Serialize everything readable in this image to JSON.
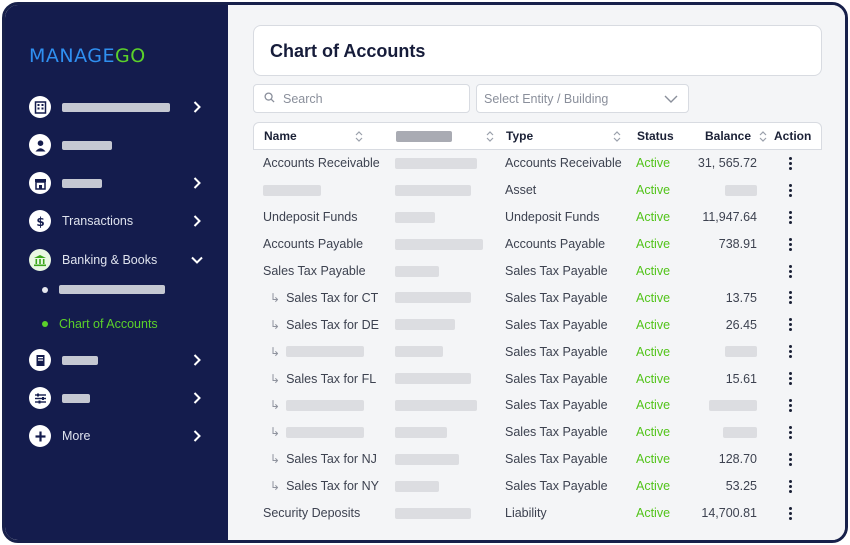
{
  "brand": {
    "logo_part1": "MANAGE",
    "logo_part2": "GO"
  },
  "sidebar": {
    "items": [
      {
        "name": "nav-properties",
        "icon": "building-icon",
        "label": "",
        "chevron": "right"
      },
      {
        "name": "nav-people",
        "icon": "person-icon",
        "label": "",
        "chevron": ""
      },
      {
        "name": "nav-leasing",
        "icon": "store-icon",
        "label": "",
        "chevron": "right"
      },
      {
        "name": "nav-transactions",
        "icon": "dollar-icon",
        "label": "Transactions",
        "chevron": "right"
      },
      {
        "name": "nav-banking",
        "icon": "bank-icon",
        "label": "Banking & Books",
        "chevron": "down"
      },
      {
        "name": "nav-documents",
        "icon": "document-icon",
        "label": "",
        "chevron": "right"
      },
      {
        "name": "nav-settings",
        "icon": "sliders-icon",
        "label": "",
        "chevron": "right"
      },
      {
        "name": "nav-more",
        "icon": "plus-icon",
        "label": "More",
        "chevron": "right"
      }
    ],
    "subitems": [
      {
        "label": "",
        "active": false
      },
      {
        "label": "Chart of Accounts",
        "active": true
      }
    ]
  },
  "page": {
    "title": "Chart of Accounts"
  },
  "filters": {
    "search_placeholder": "Search",
    "entity_select": "Select Entity / Building"
  },
  "table": {
    "columns": {
      "name": "Name",
      "col2": "",
      "type": "Type",
      "status": "Status",
      "balance": "Balance",
      "action": "Action"
    },
    "rows": [
      {
        "name": "Accounts Receivable",
        "indent": false,
        "type": "Accounts Receivable",
        "status": "Active",
        "balance": "31, 565.72"
      },
      {
        "name": "",
        "indent": false,
        "type": "Asset",
        "status": "Active",
        "balance": ""
      },
      {
        "name": "Undeposit Funds",
        "indent": false,
        "type": "Undeposit Funds",
        "status": "Active",
        "balance": "11,947.64"
      },
      {
        "name": "Accounts Payable",
        "indent": false,
        "type": "Accounts Payable",
        "status": "Active",
        "balance": "738.91"
      },
      {
        "name": "Sales Tax Payable",
        "indent": false,
        "type": "Sales Tax Payable",
        "status": "Active",
        "balance": ""
      },
      {
        "name": "Sales Tax for CT",
        "indent": true,
        "type": "Sales Tax Payable",
        "status": "Active",
        "balance": "13.75"
      },
      {
        "name": "Sales Tax for DE",
        "indent": true,
        "type": "Sales Tax Payable",
        "status": "Active",
        "balance": "26.45"
      },
      {
        "name": "",
        "indent": true,
        "type": "Sales Tax Payable",
        "status": "Active",
        "balance": ""
      },
      {
        "name": "Sales Tax for FL",
        "indent": true,
        "type": "Sales Tax Payable",
        "status": "Active",
        "balance": "15.61"
      },
      {
        "name": "",
        "indent": true,
        "type": "Sales Tax Payable",
        "status": "Active",
        "balance": ""
      },
      {
        "name": "",
        "indent": true,
        "type": "Sales Tax Payable",
        "status": "Active",
        "balance": ""
      },
      {
        "name": "Sales Tax for NJ",
        "indent": true,
        "type": "Sales Tax Payable",
        "status": "Active",
        "balance": "128.70"
      },
      {
        "name": "Sales Tax for NY",
        "indent": true,
        "type": "Sales Tax Payable",
        "status": "Active",
        "balance": "53.25"
      },
      {
        "name": "Security Deposits",
        "indent": false,
        "type": "Liability",
        "status": "Active",
        "balance": "14,700.81"
      }
    ]
  },
  "colors": {
    "sidebar": "#141c4d",
    "accent_green": "#5bd12a",
    "accent_blue": "#2f8ff0",
    "status_active": "#52c41a"
  }
}
